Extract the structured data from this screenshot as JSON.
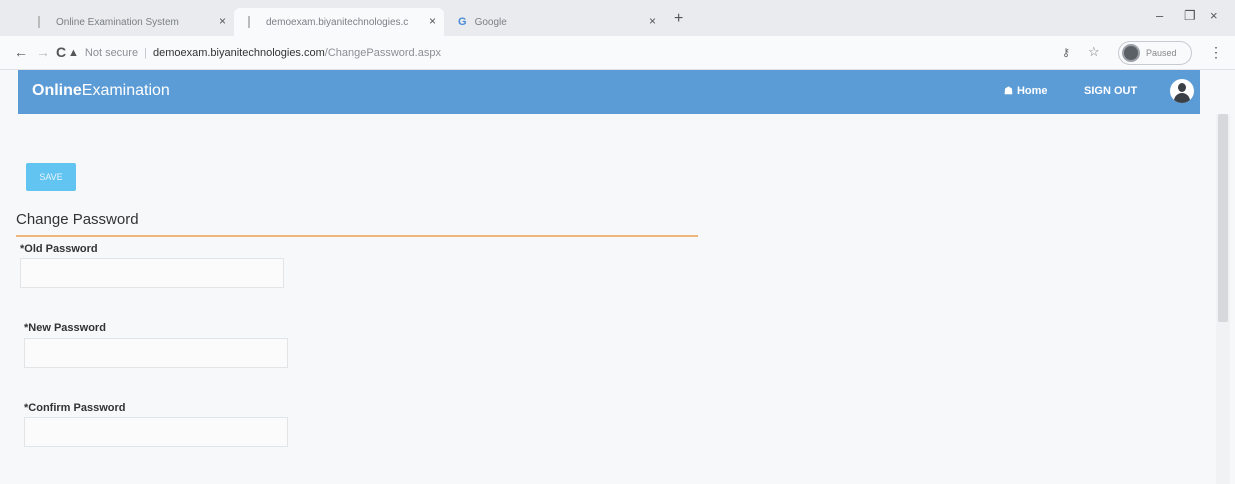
{
  "browser": {
    "tabs": [
      {
        "title": "Online Examination System",
        "close": "×"
      },
      {
        "title": "demoexam.biyanitechnologies.c",
        "close": "×"
      },
      {
        "title": "Google",
        "icon": "G",
        "close": "×"
      }
    ],
    "new_tab": "+",
    "window_controls": {
      "minimize": "–",
      "restore": "❐",
      "close": "×"
    },
    "nav": {
      "back": "←",
      "forward": "→",
      "reload": "C"
    },
    "address": {
      "security_label": "Not secure",
      "separator": "|",
      "host": "demoexam.biyanitechnologies.com",
      "path": "/ChangePassword.aspx"
    },
    "profile_status": "Paused"
  },
  "header": {
    "brand_bold": "Online",
    "brand_rest": "Examination",
    "home_label": "Home",
    "signout_label": "SIGN OUT"
  },
  "main": {
    "save_label": "SAVE",
    "title": "Change Password",
    "fields": [
      {
        "label": "*Old Password",
        "value": ""
      },
      {
        "label": "*New Password",
        "value": ""
      },
      {
        "label": "*Confirm Password",
        "value": ""
      }
    ]
  },
  "colors": {
    "header_bg": "#5b9bd6",
    "save_button": "#62c4f1",
    "title_rule": "#f0b57a"
  }
}
